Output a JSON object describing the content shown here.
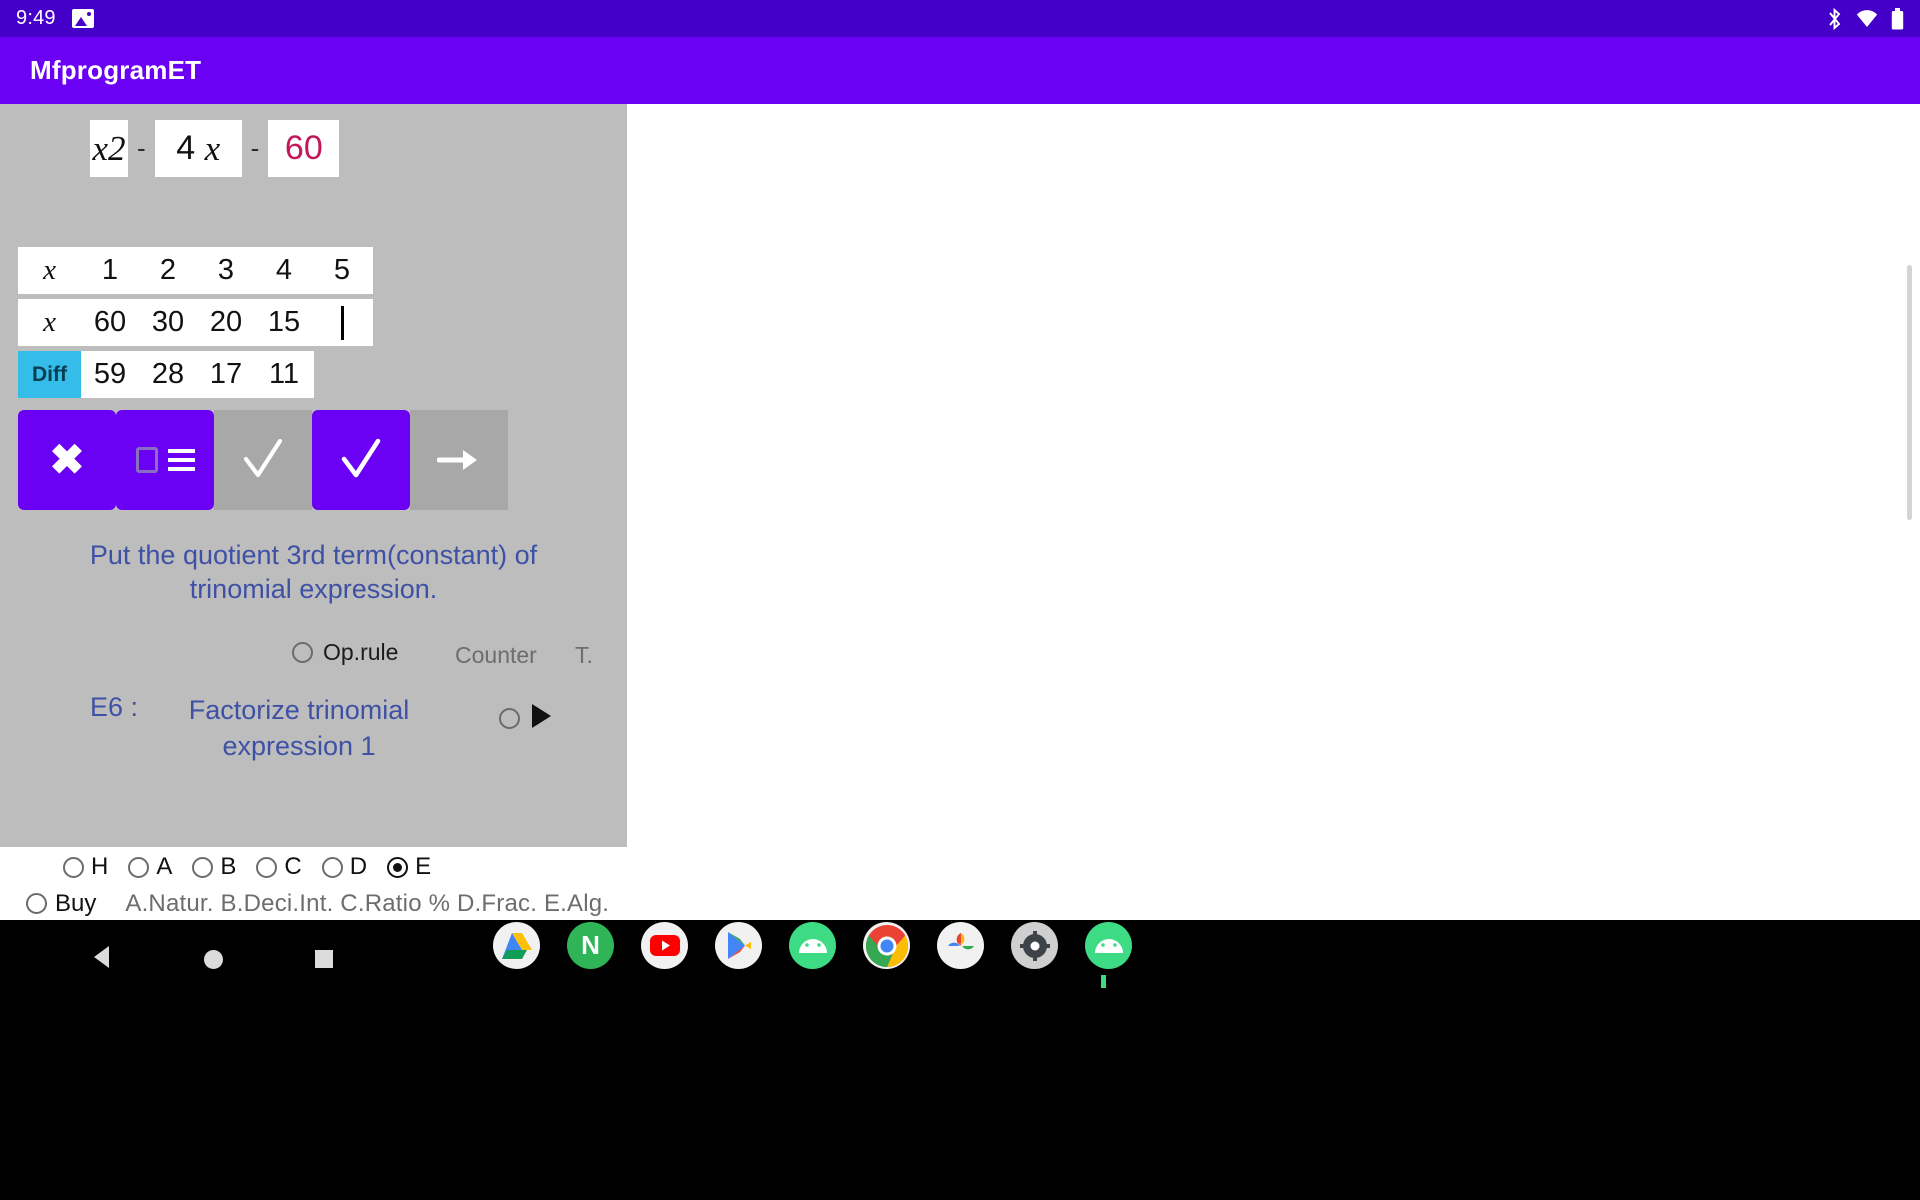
{
  "status_bar": {
    "time": "9:49",
    "left_icons": [
      "image-icon"
    ],
    "right_icons": [
      "bluetooth-icon",
      "wifi-icon",
      "battery-icon"
    ]
  },
  "app_bar": {
    "title": "MfprogramET"
  },
  "expression": {
    "term1": "x",
    "term1_exponent": "2",
    "operator1": "-",
    "term2_coefficient": "4",
    "term2_variable": "x",
    "operator2": "-",
    "term3": "60",
    "term3_color": "#c2185b"
  },
  "table": {
    "row1": {
      "label": "x",
      "values": [
        "1",
        "2",
        "3",
        "4",
        "5"
      ]
    },
    "row2": {
      "label": "x",
      "values": [
        "60",
        "30",
        "20",
        "15"
      ],
      "caret": true
    },
    "row3": {
      "label": "Diff",
      "label_bg": "#35bdea",
      "values": [
        "59",
        "28",
        "17",
        "11"
      ]
    }
  },
  "buttons": [
    {
      "name": "clear-button",
      "icon": "x-icon",
      "style": "purple"
    },
    {
      "name": "keyboard-button",
      "icon": "square-menu-icon",
      "style": "purple"
    },
    {
      "name": "check-button-1",
      "icon": "check-icon",
      "style": "gray"
    },
    {
      "name": "check-button-2",
      "icon": "check-icon",
      "style": "purple"
    },
    {
      "name": "next-button",
      "icon": "arrow-right-icon",
      "style": "gray"
    }
  ],
  "instruction": {
    "line1": "Put the quotient 3rd term(constant) of",
    "line2": "trinomial expression."
  },
  "options": {
    "op_rule_label": "Op.rule",
    "op_rule_checked": false,
    "counter_label": "Counter",
    "t_label": "T."
  },
  "exercise": {
    "code": "E6 :",
    "name_line1": "Factorize trinomial",
    "name_line2": "expression 1",
    "radio_checked": false,
    "play_icon": "play-icon"
  },
  "levels": {
    "items": [
      {
        "label": "H",
        "checked": false
      },
      {
        "label": "A",
        "checked": false
      },
      {
        "label": "B",
        "checked": false
      },
      {
        "label": "C",
        "checked": false
      },
      {
        "label": "D",
        "checked": false
      },
      {
        "label": "E",
        "checked": true
      }
    ],
    "buy_label": "Buy",
    "buy_checked": false,
    "legend": "A.Natur. B.Deci.Int. C.Ratio % D.Frac. E.Alg."
  },
  "navigation": {
    "back": "back-icon",
    "home": "home-icon",
    "recent": "recent-apps-icon"
  },
  "taskbar": {
    "apps": [
      {
        "name": "google-drive-icon",
        "label": ""
      },
      {
        "name": "nordvpn-icon",
        "label": "N"
      },
      {
        "name": "youtube-icon",
        "label": ""
      },
      {
        "name": "google-play-icon",
        "label": ""
      },
      {
        "name": "android-app-icon-1",
        "label": ""
      },
      {
        "name": "chrome-icon",
        "label": ""
      },
      {
        "name": "google-photos-icon",
        "label": ""
      },
      {
        "name": "settings-icon",
        "label": ""
      },
      {
        "name": "android-app-icon-2",
        "label": ""
      }
    ]
  },
  "colors": {
    "status_bar": "#4400c8",
    "app_bar": "#6a00f4",
    "panel_bg": "#bdbdbd",
    "accent_purple": "#6a00f4",
    "diff_cyan": "#35bdea",
    "text_blue": "#3f51a5",
    "term3_crimson": "#c2185b"
  }
}
